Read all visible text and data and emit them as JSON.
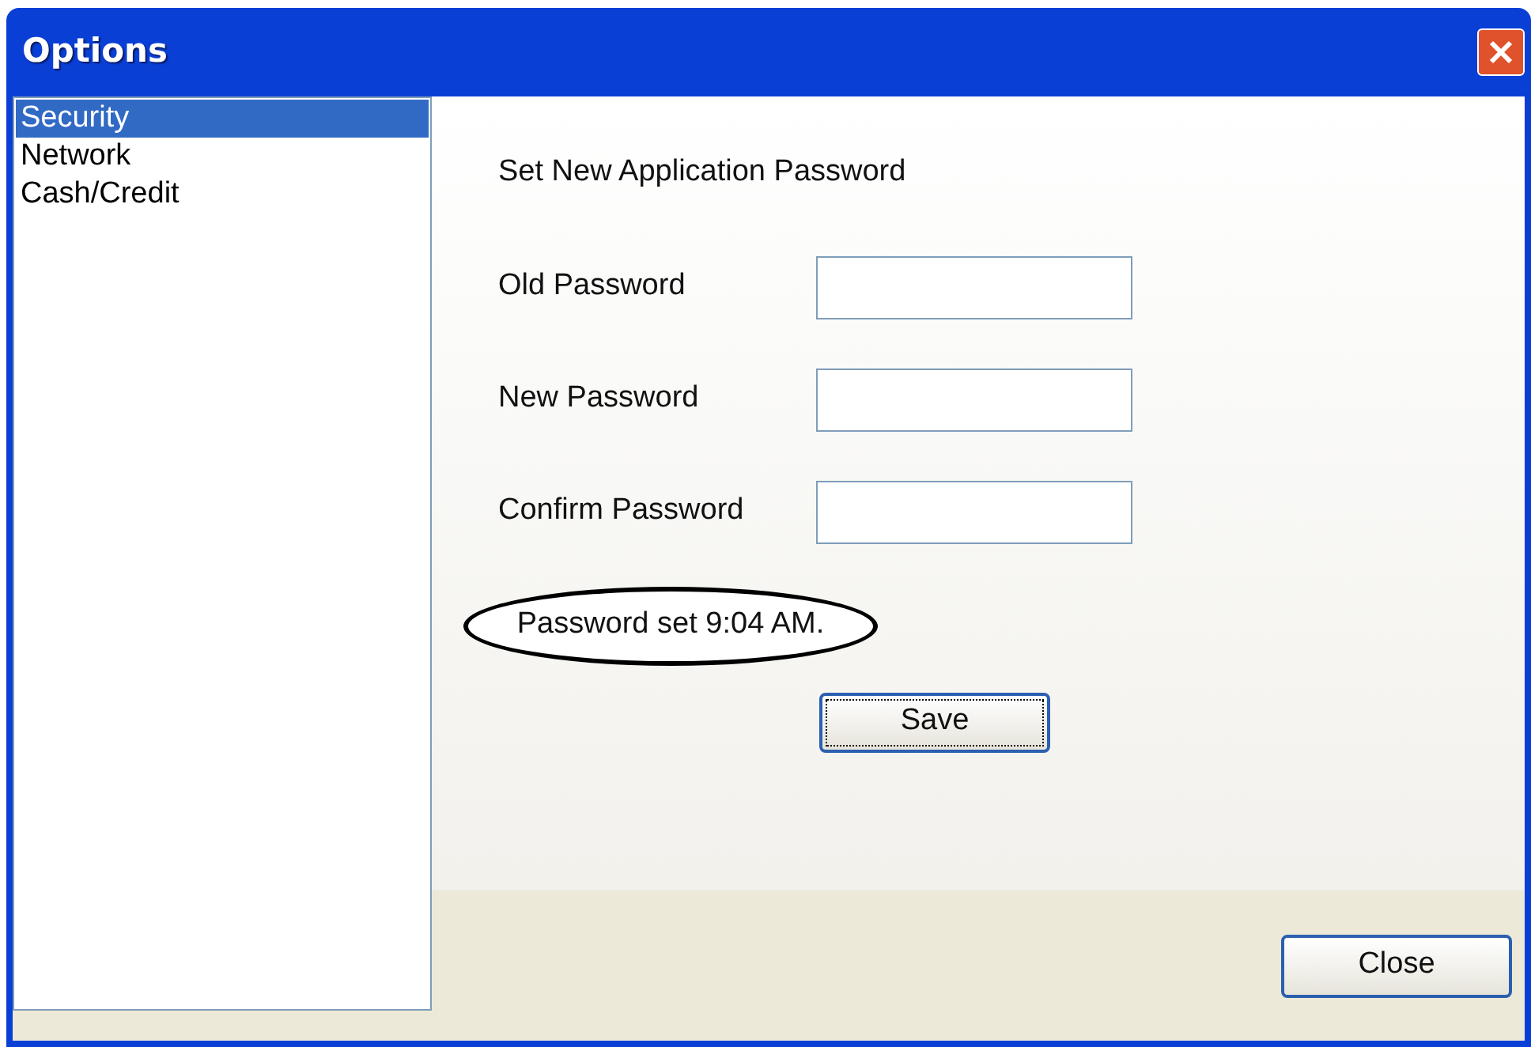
{
  "window": {
    "title": "Options"
  },
  "sidebar": {
    "items": [
      {
        "label": "Security",
        "selected": true
      },
      {
        "label": "Network",
        "selected": false
      },
      {
        "label": "Cash/Credit",
        "selected": false
      }
    ]
  },
  "panel": {
    "heading": "Set New Application Password",
    "fields": [
      {
        "label": "Old Password"
      },
      {
        "label": "New Password"
      },
      {
        "label": "Confirm Password"
      }
    ],
    "status": "Password set 9:04 AM.",
    "save_button": "Save"
  },
  "buttons": [
    "Close"
  ]
}
